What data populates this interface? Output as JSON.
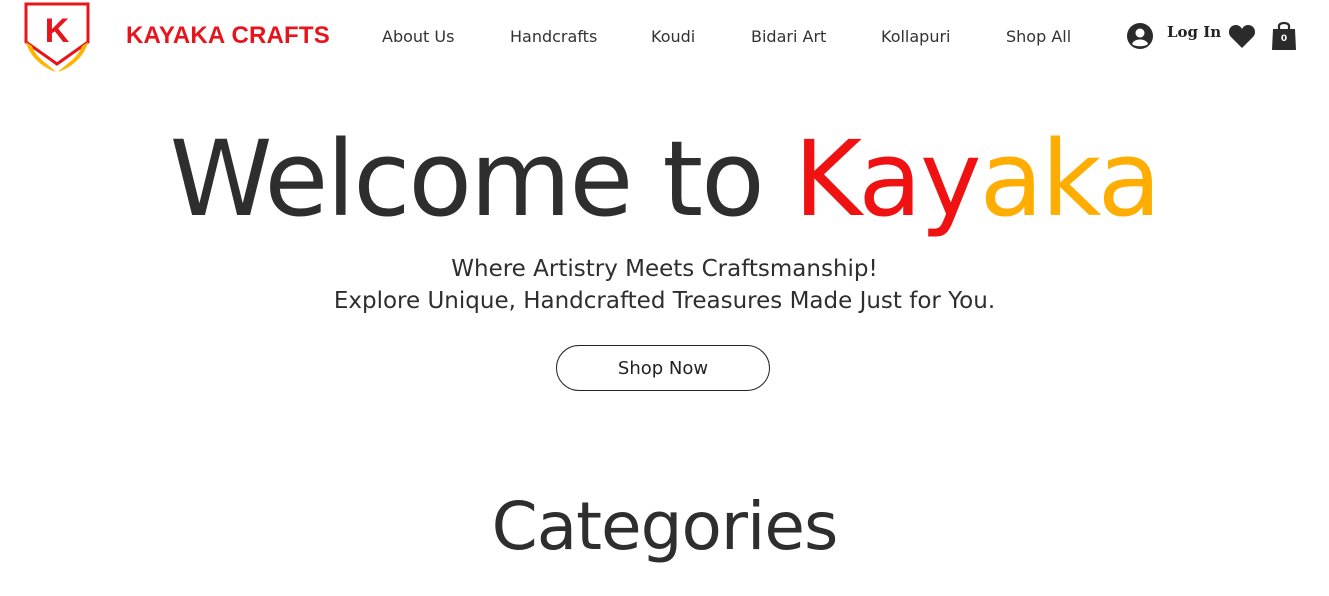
{
  "header": {
    "brand": "KAYAKA CRAFTS",
    "logo_letter": "K",
    "logo_icon": "hands-shield-logo",
    "nav": [
      "About Us",
      "Handcrafts",
      "Koudi",
      "Bidari Art",
      "Kollapuri",
      "Shop All"
    ],
    "login_label": "Log In",
    "login_icon": "user-circle-icon",
    "wishlist_icon": "heart-icon",
    "cart_icon": "shopping-bag-icon",
    "cart_count": "0"
  },
  "hero": {
    "title_part1": "Welcome to ",
    "title_red": "Kay",
    "title_yellow": "aka",
    "tagline_1": "Where Artistry Meets Craftsmanship!",
    "tagline_2": "Explore Unique, Handcrafted Treasures Made Just for You.",
    "cta": "Shop Now"
  },
  "section": {
    "categories_title": "Categories"
  },
  "colors": {
    "brand_red": "#e8141c",
    "accent_yellow": "#ffad00",
    "text_dark": "#2e2e2e"
  }
}
